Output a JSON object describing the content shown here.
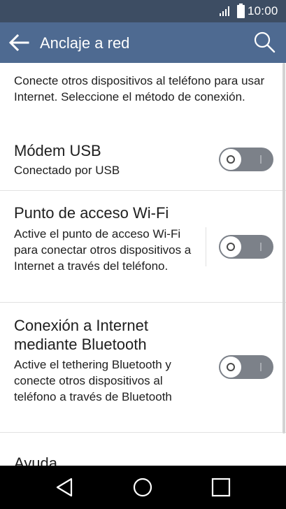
{
  "status_bar": {
    "time": "10:00",
    "icons": [
      "signal-icon",
      "battery-icon"
    ]
  },
  "app_bar": {
    "title": "Anclaje a red",
    "back_icon": "arrow-left-icon",
    "search_icon": "search-icon"
  },
  "description": "Conecte otros dispositivos al teléfono para usar Internet. Seleccione el método de conexión.",
  "items": [
    {
      "title": "Módem USB",
      "subtitle": "Conectado por USB",
      "enabled": false
    },
    {
      "title": "Punto de acceso Wi-Fi",
      "subtitle": "Active el punto de acceso Wi-Fi para conectar otros dispositivos a Internet a través del teléfono.",
      "enabled": false
    },
    {
      "title": "Conexión a Internet mediante Bluetooth",
      "subtitle": "Active el tethering Bluetooth y conecte otros dispositivos al teléfono a través de Bluetooth",
      "enabled": false
    }
  ],
  "help": {
    "title": "Ayuda"
  },
  "nav_bar": {
    "icons": [
      "back-triangle-icon",
      "home-circle-icon",
      "recents-square-icon"
    ]
  },
  "colors": {
    "status_bar": "#3d4d63",
    "app_bar": "#4e6a91",
    "toggle_off": "#7c8189",
    "nav_bar": "#000000"
  }
}
